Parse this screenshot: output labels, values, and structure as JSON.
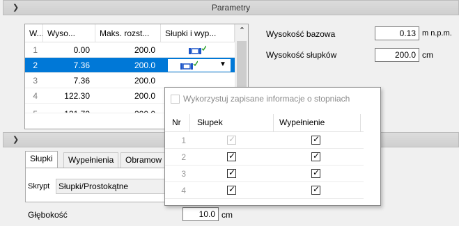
{
  "parametry_section": {
    "title": "Parametry",
    "chevron": "chevron-down-icon"
  },
  "grid": {
    "columns": [
      "W...",
      "Wyso...",
      "Maks. rozst...",
      "Słupki i wyp..."
    ],
    "rows": [
      {
        "w": "1",
        "wysokosc": "0.00",
        "maks": "200.0"
      },
      {
        "w": "2",
        "wysokosc": "7.36",
        "maks": "200.0"
      },
      {
        "w": "3",
        "wysokosc": "7.36",
        "maks": "200.0"
      },
      {
        "w": "4",
        "wysokosc": "122.30",
        "maks": "200.0"
      },
      {
        "w": "5",
        "wysokosc": "131.72",
        "maks": "200.0"
      }
    ],
    "selected_row": 2
  },
  "fields": {
    "wysokosc_bazowa_label": "Wysokość bazowa",
    "wysokosc_bazowa_value": "0.13",
    "wysokosc_bazowa_unit": "m n.p.m.",
    "wysokosc_slupkow_label": "Wysokość słupków",
    "wysokosc_slupkow_value": "200.0",
    "wysokosc_slupkow_unit": "cm"
  },
  "tabs": [
    "Słupki",
    "Wypełnienia",
    "Obramow"
  ],
  "skrypt": {
    "label": "Skrypt",
    "value": "Słupki/Prostokątne"
  },
  "glebokosc": {
    "label": "Głębokość",
    "value": "10.0",
    "unit": "cm"
  },
  "popup": {
    "checkbox_label": "Wykorzystuj zapisane informacje o stopniach",
    "columns": [
      "Nr",
      "Słupek",
      "Wypełnienie"
    ],
    "rows": [
      {
        "nr": "1",
        "slupek": true,
        "wypelnienie": true,
        "slupek_disabled": true
      },
      {
        "nr": "2",
        "slupek": true,
        "wypelnienie": true,
        "slupek_disabled": false
      },
      {
        "nr": "3",
        "slupek": true,
        "wypelnienie": true,
        "slupek_disabled": false
      },
      {
        "nr": "4",
        "slupek": true,
        "wypelnienie": true,
        "slupek_disabled": false
      }
    ]
  },
  "colors": {
    "selection": "#0078d7",
    "icon_blue": "#1e56c8",
    "icon_green": "#2aa02a"
  }
}
